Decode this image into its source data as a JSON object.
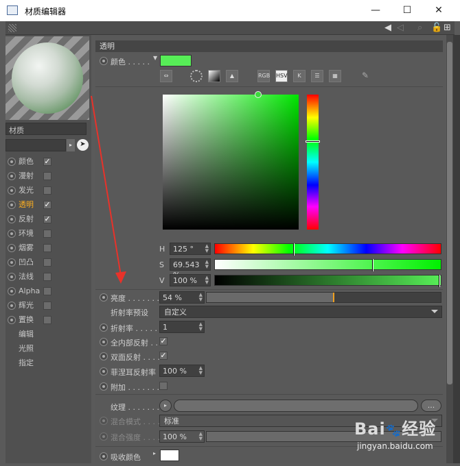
{
  "window": {
    "title": "材质编辑器",
    "minimize": "—",
    "maximize": "☐",
    "close": "✕"
  },
  "material": {
    "name_label": "材质"
  },
  "channels": [
    {
      "label": "颜色",
      "checked": true
    },
    {
      "label": "漫射",
      "checked": false
    },
    {
      "label": "发光",
      "checked": false
    },
    {
      "label": "透明",
      "checked": true,
      "active": true
    },
    {
      "label": "反射",
      "checked": true
    },
    {
      "label": "环境",
      "checked": false
    },
    {
      "label": "烟雾",
      "checked": false
    },
    {
      "label": "凹凸",
      "checked": false
    },
    {
      "label": "法线",
      "checked": false
    },
    {
      "label": "Alpha",
      "checked": false
    },
    {
      "label": "辉光",
      "checked": false
    },
    {
      "label": "置换",
      "checked": false
    }
  ],
  "sub_items": [
    "编辑",
    "光照",
    "指定"
  ],
  "section": {
    "title": "透明"
  },
  "color": {
    "label": "颜色 . . . . .",
    "swatch": "#57ee57",
    "modes": [
      "RGB",
      "HSV",
      "K"
    ],
    "active_mode": "HSV",
    "h": {
      "label": "H",
      "value": "125 °",
      "fraction": 0.347
    },
    "s": {
      "label": "S",
      "value": "69.543 %",
      "fraction": 0.695
    },
    "v": {
      "label": "V",
      "value": "100 %",
      "fraction": 1.0
    }
  },
  "brightness": {
    "label": "亮度 . . . . . . . .",
    "value": "54 %",
    "fraction": 0.54
  },
  "ior_preset": {
    "label": "折射率预设",
    "value": "自定义"
  },
  "ior": {
    "label": "折射率 . . . . . .",
    "value": "1"
  },
  "total_internal": {
    "label": "全内部反射 . .",
    "checked": true
  },
  "double_sided": {
    "label": "双面反射 . . . .",
    "checked": true
  },
  "fresnel": {
    "label": "菲涅耳反射率",
    "value": "100 %"
  },
  "additive": {
    "label": "附加 . . . . . . . .",
    "checked": false
  },
  "texture": {
    "label": "纹理 . . . . . . . .",
    "more": "..."
  },
  "blend_mode": {
    "label": "混合模式 . . . .",
    "value": "标准"
  },
  "blend_strength": {
    "label": "混合强度 . . . .",
    "value": "100 %"
  },
  "absorption": {
    "label": "吸收颜色",
    "swatch": "#ffffff"
  },
  "watermark": {
    "brand": "Bai",
    "brand_suffix": "经验",
    "url": "jingyan.baidu.com"
  }
}
